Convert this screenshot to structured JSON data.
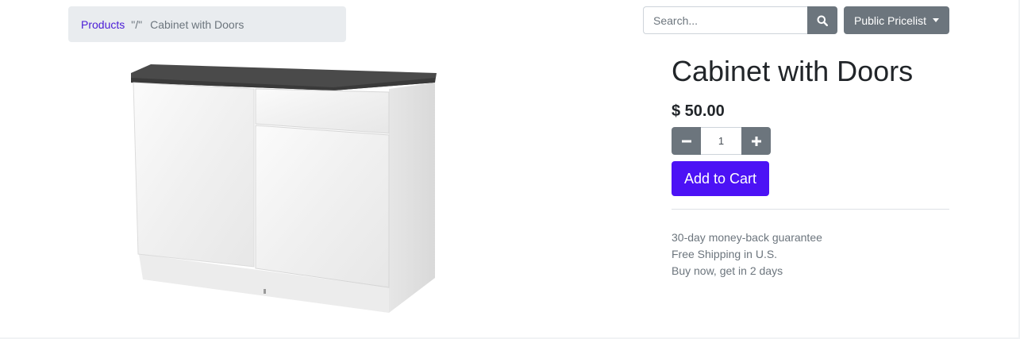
{
  "breadcrumb": {
    "root_label": "Products",
    "separator": "\"/\"",
    "current": "Cabinet with Doors"
  },
  "search": {
    "placeholder": "Search...",
    "value": "",
    "icon": "search-icon"
  },
  "pricelist": {
    "label": "Public Pricelist",
    "icon": "caret-down-icon"
  },
  "product": {
    "name": "Cabinet with Doors",
    "price": "$ 50.00",
    "quantity": "1",
    "add_to_cart_label": "Add to Cart",
    "image_subject": "white-cabinet-with-doors"
  },
  "benefits": [
    "30-day money-back guarantee",
    "Free Shipping in U.S.",
    "Buy now, get in 2 days"
  ],
  "colors": {
    "accent": "#4c12f5",
    "link": "#4a1cd6",
    "secondary": "#6c757d",
    "breadcrumb_bg": "#e9ecef"
  }
}
